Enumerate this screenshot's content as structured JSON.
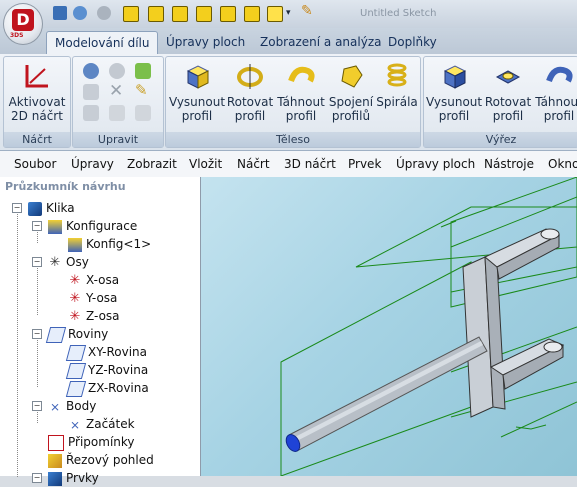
{
  "app": {
    "logo_letter": "D",
    "logo_sub": "3DS",
    "window_title": "Untitled Sketch"
  },
  "quick_access": [
    "new-icon",
    "open-icon",
    "save-icon",
    "undo-icon",
    "redo-icon",
    "view-front-icon",
    "view-top-icon",
    "view-right-icon",
    "view-iso-icon",
    "view-left-icon",
    "view-back-icon",
    "view-bottom-icon",
    "shaded-view-icon",
    "pencil-icon"
  ],
  "tabs": [
    {
      "label": "Modelování dílu",
      "active": true
    },
    {
      "label": "Úpravy ploch"
    },
    {
      "label": "Zobrazení a analýza"
    },
    {
      "label": "Doplňky"
    }
  ],
  "ribbon": {
    "sketch_group": {
      "label": "Náčrt",
      "button": "Aktivovat 2D náčrt"
    },
    "edit_group": {
      "label": "Upravit"
    },
    "body_group": {
      "label": "Těleso",
      "buttons": [
        "Vysunout profil",
        "Rotovat profil",
        "Táhnout profil",
        "Spojení profilů",
        "Spirála"
      ]
    },
    "cut_group": {
      "label": "Výřez",
      "buttons": [
        "Vysunout profil",
        "Rotovat profil",
        "Táhnout profil"
      ]
    }
  },
  "menubar": [
    "Soubor",
    "Úpravy",
    "Zobrazit",
    "Vložit",
    "Náčrt",
    "3D náčrt",
    "Prvek",
    "Úpravy ploch",
    "Nástroje",
    "Okno"
  ],
  "explorer": {
    "title": "Průzkumník návrhu",
    "tree": [
      {
        "label": "Klika",
        "level": 0
      },
      {
        "label": "Konfigurace",
        "level": 1
      },
      {
        "label": "Konfig<1>",
        "level": 2
      },
      {
        "label": "Osy",
        "level": 1
      },
      {
        "label": "X-osa",
        "level": 2
      },
      {
        "label": "Y-osa",
        "level": 2
      },
      {
        "label": "Z-osa",
        "level": 2
      },
      {
        "label": "Roviny",
        "level": 1
      },
      {
        "label": "XY-Rovina",
        "level": 2
      },
      {
        "label": "YZ-Rovina",
        "level": 2
      },
      {
        "label": "ZX-Rovina",
        "level": 2
      },
      {
        "label": "Body",
        "level": 1
      },
      {
        "label": "Začátek",
        "level": 2
      },
      {
        "label": "Připomínky",
        "level": 1
      },
      {
        "label": "Řezový pohled",
        "level": 1
      },
      {
        "label": "Prvky",
        "level": 1
      }
    ]
  },
  "colors": {
    "accent": "#c0141e",
    "ribbon_bg": "#eef2f7",
    "viewport": "#a6d3e4",
    "sketch_green": "#1a8a1a"
  }
}
